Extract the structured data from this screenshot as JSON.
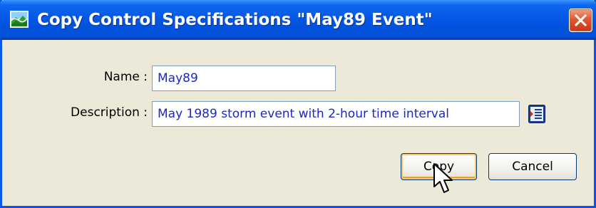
{
  "window": {
    "title": "Copy Control Specifications \"May89 Event\"",
    "app_icon": "landscape-icon",
    "close_icon": "close-icon"
  },
  "form": {
    "name_label": "Name :",
    "name_value": "May89",
    "description_label": "Description :",
    "description_value": "May 1989 storm event with 2-hour time interval",
    "edit_icon": "edit-description-icon"
  },
  "buttons": {
    "copy_label": "Copy",
    "cancel_label": "Cancel"
  },
  "colors": {
    "titlebar": "#0458e4",
    "window_bg": "#ece9d8",
    "field_text": "#1a28c8",
    "close_button": "#e3572e"
  }
}
